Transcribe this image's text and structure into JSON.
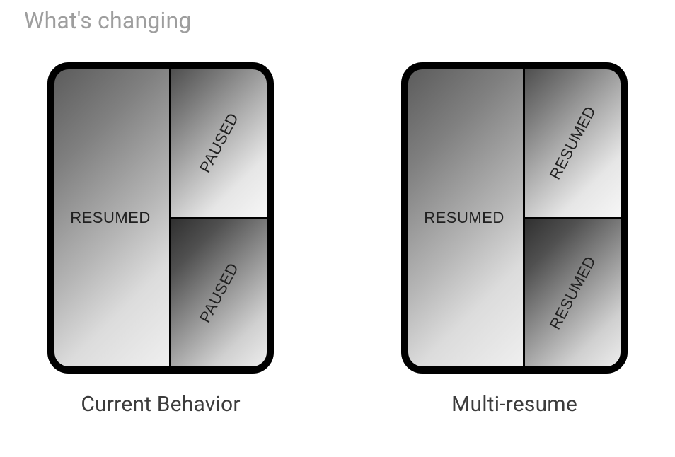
{
  "heading": "What's changing",
  "devices": {
    "left": {
      "caption": "Current Behavior",
      "leftApp": "RESUMED",
      "topRight": "PAUSED",
      "bottomRight": "PAUSED"
    },
    "right": {
      "caption": "Multi-resume",
      "leftApp": "RESUMED",
      "topRight": "RESUMED",
      "bottomRight": "RESUMED"
    }
  }
}
